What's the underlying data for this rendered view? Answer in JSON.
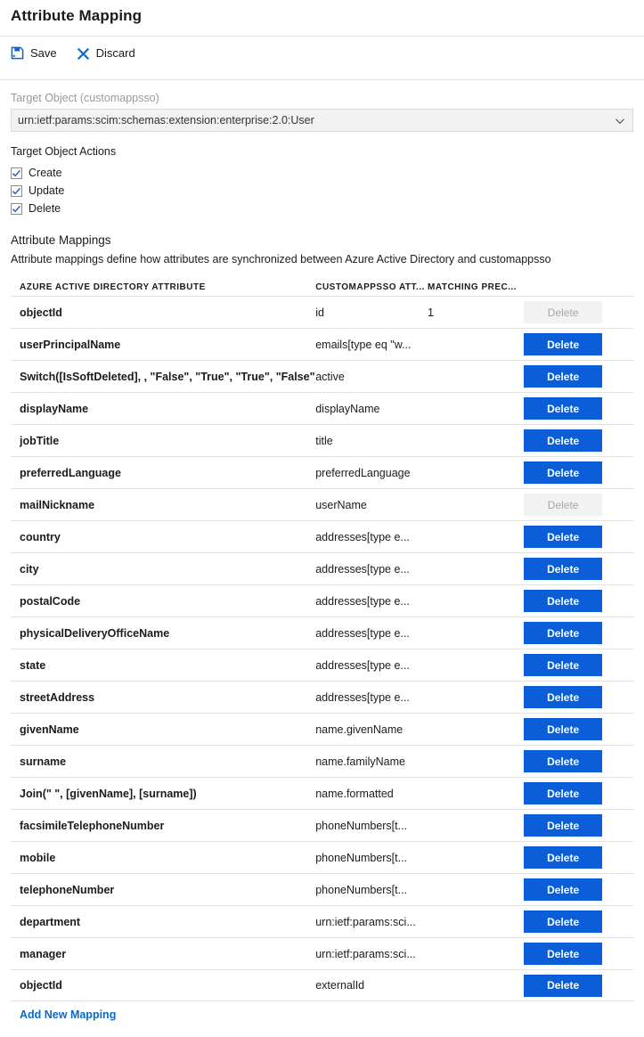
{
  "header": {
    "title": "Attribute Mapping"
  },
  "toolbar": {
    "save_label": "Save",
    "save_icon": "save-floppy-icon",
    "discard_label": "Discard",
    "discard_icon": "close-x-icon"
  },
  "target_object": {
    "label": "Target Object (customappsso)",
    "selected_value": "urn:ietf:params:scim:schemas:extension:enterprise:2.0:User",
    "chevron_icon": "chevron-down-icon"
  },
  "target_object_actions": {
    "label": "Target Object Actions",
    "items": [
      {
        "label": "Create",
        "checked": true
      },
      {
        "label": "Update",
        "checked": true
      },
      {
        "label": "Delete",
        "checked": true
      }
    ]
  },
  "attribute_mappings": {
    "heading": "Attribute Mappings",
    "description": "Attribute mappings define how attributes are synchronized between Azure Active Directory and customappsso",
    "columns": {
      "source": "AZURE ACTIVE DIRECTORY ATTRIBUTE",
      "target": "CUSTOMAPPSSO ATT...",
      "precedence": "MATCHING PREC...",
      "actions": ""
    },
    "delete_label": "Delete",
    "add_link_label": "Add New Mapping",
    "rows": [
      {
        "source": "objectId",
        "target": "id",
        "precedence": "1",
        "delete_enabled": false
      },
      {
        "source": "userPrincipalName",
        "target": "emails[type eq \"w...",
        "precedence": "",
        "delete_enabled": true
      },
      {
        "source": "Switch([IsSoftDeleted], , \"False\", \"True\", \"True\", \"False\")",
        "target": "active",
        "precedence": "",
        "delete_enabled": true
      },
      {
        "source": "displayName",
        "target": "displayName",
        "precedence": "",
        "delete_enabled": true
      },
      {
        "source": "jobTitle",
        "target": "title",
        "precedence": "",
        "delete_enabled": true
      },
      {
        "source": "preferredLanguage",
        "target": "preferredLanguage",
        "precedence": "",
        "delete_enabled": true
      },
      {
        "source": "mailNickname",
        "target": "userName",
        "precedence": "",
        "delete_enabled": false
      },
      {
        "source": "country",
        "target": "addresses[type e...",
        "precedence": "",
        "delete_enabled": true
      },
      {
        "source": "city",
        "target": "addresses[type e...",
        "precedence": "",
        "delete_enabled": true
      },
      {
        "source": "postalCode",
        "target": "addresses[type e...",
        "precedence": "",
        "delete_enabled": true
      },
      {
        "source": "physicalDeliveryOfficeName",
        "target": "addresses[type e...",
        "precedence": "",
        "delete_enabled": true
      },
      {
        "source": "state",
        "target": "addresses[type e...",
        "precedence": "",
        "delete_enabled": true
      },
      {
        "source": "streetAddress",
        "target": "addresses[type e...",
        "precedence": "",
        "delete_enabled": true
      },
      {
        "source": "givenName",
        "target": "name.givenName",
        "precedence": "",
        "delete_enabled": true
      },
      {
        "source": "surname",
        "target": "name.familyName",
        "precedence": "",
        "delete_enabled": true
      },
      {
        "source": "Join(\" \", [givenName], [surname])",
        "target": "name.formatted",
        "precedence": "",
        "delete_enabled": true
      },
      {
        "source": "facsimileTelephoneNumber",
        "target": "phoneNumbers[t...",
        "precedence": "",
        "delete_enabled": true
      },
      {
        "source": "mobile",
        "target": "phoneNumbers[t...",
        "precedence": "",
        "delete_enabled": true
      },
      {
        "source": "telephoneNumber",
        "target": "phoneNumbers[t...",
        "precedence": "",
        "delete_enabled": true
      },
      {
        "source": "department",
        "target": "urn:ietf:params:sci...",
        "precedence": "",
        "delete_enabled": true
      },
      {
        "source": "manager",
        "target": "urn:ietf:params:sci...",
        "precedence": "",
        "delete_enabled": true
      },
      {
        "source": "objectId",
        "target": "externalId",
        "precedence": "",
        "delete_enabled": true
      }
    ]
  },
  "colors": {
    "accent_blue": "#0b5ed8",
    "link_blue": "#0b69c7",
    "icon_blue": "#0b65cc",
    "disabled_bg": "#f2f2f2",
    "disabled_text": "#a6a6a6",
    "border": "#e3e3e3"
  }
}
